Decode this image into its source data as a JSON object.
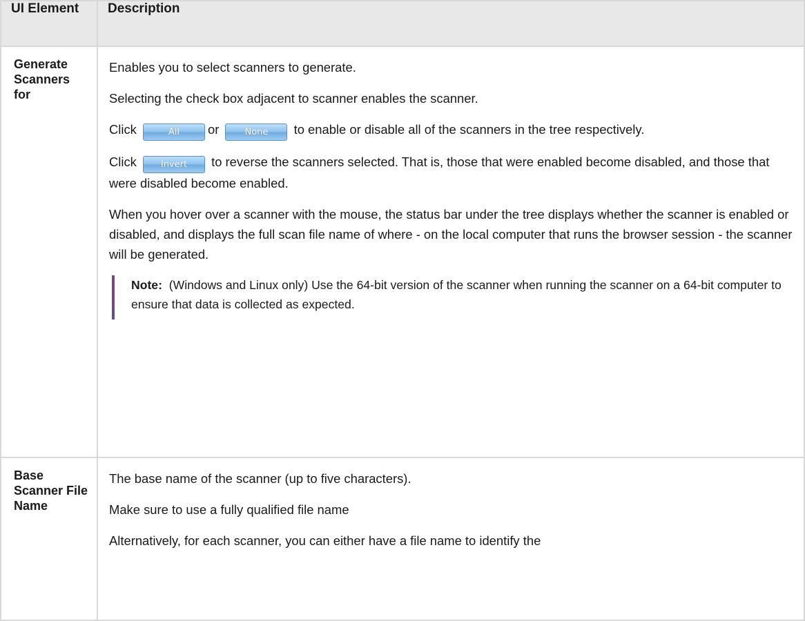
{
  "header": {
    "col1": "UI Element",
    "col2": "Description"
  },
  "rows": [
    {
      "element": "Generate Scanners for",
      "p1": "Enables you to select scanners to generate.",
      "p2": "Selecting the check box adjacent to scanner enables the scanner.",
      "p3_prefix": "Click",
      "p3_btn_all": "All",
      "p3_or": "or",
      "p3_btn_none": "None",
      "p3_suffix": "to enable or disable all of the scanners in the tree respectively.",
      "p4_prefix": "Click",
      "p4_btn_invert": "Invert",
      "p4_suffix": "to reverse the scanners selected. That is, those that were enabled become disabled, and those that were disabled become enabled.",
      "p5": "When you hover over a scanner with the mouse, the status bar under the tree displays whether the scanner is enabled or disabled, and displays the full scan file name of where - on the local computer that runs the browser session - the scanner will be generated.",
      "note_label": "Note:",
      "note_text": "(Windows and Linux only) Use the 64-bit version of the scanner when running the scanner on a 64-bit computer to ensure that data is collected as expected."
    },
    {
      "element": "Base Scanner File Name",
      "p1": "The base name of the scanner (up to five characters).",
      "p2": "Make sure to use a fully qualified file name",
      "p3": "Alternatively, for each scanner, you can either have a file name to identify the"
    }
  ]
}
